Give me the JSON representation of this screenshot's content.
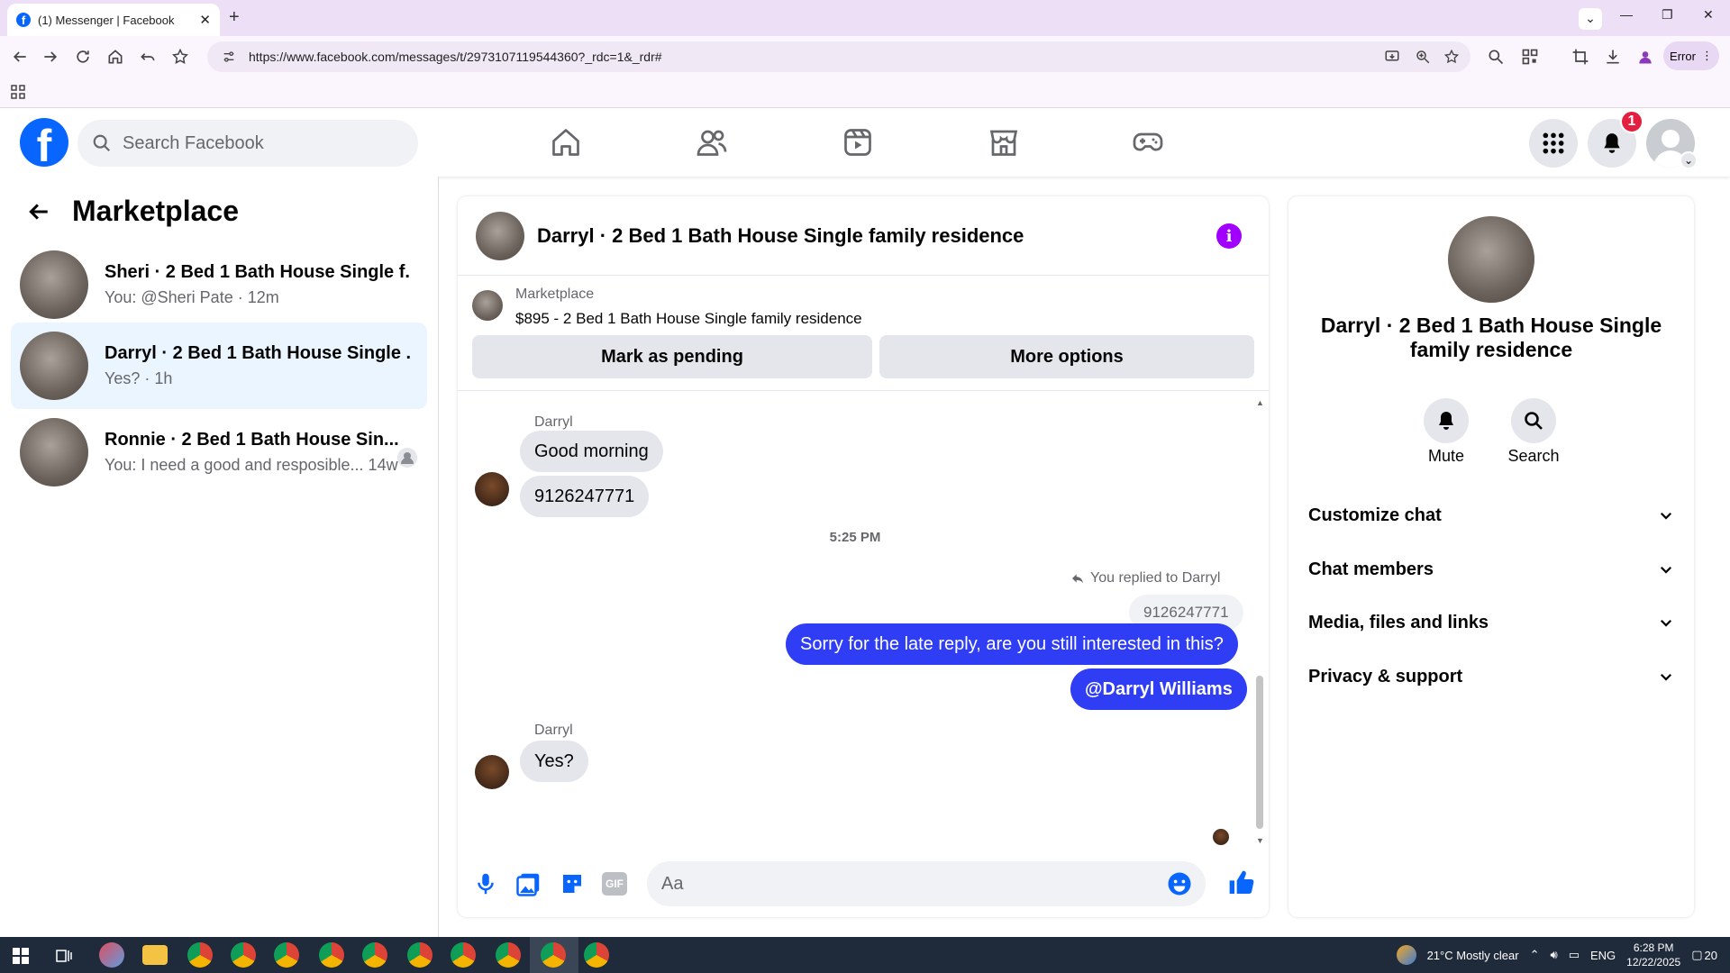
{
  "browser": {
    "tab_title": "(1) Messenger | Facebook",
    "url": "https://www.facebook.com/messages/t/2973107119544360?_rdc=1&_rdr#",
    "profile_button": "Error"
  },
  "fb": {
    "logo": "f",
    "search_placeholder": "Search Facebook",
    "notification_count": "1"
  },
  "left": {
    "title": "Marketplace",
    "conversations": [
      {
        "name": "Sheri · 2 Bed 1 Bath House Single f...",
        "preview": "You: @Sheri Pate · 12m"
      },
      {
        "name": "Darryl · 2 Bed 1 Bath House Single ...",
        "preview": "Yes? · 1h"
      },
      {
        "name": "Ronnie · 2 Bed 1 Bath House Sin...",
        "preview": "You: I need a good and resposible... 14w"
      }
    ]
  },
  "chat": {
    "title": "Darryl · 2 Bed 1 Bath House Single family residence",
    "marketplace_label": "Marketplace",
    "listing": "$895 - 2 Bed 1 Bath House Single family residence",
    "mark_pending": "Mark as pending",
    "more_options": "More options",
    "messages": {
      "sender1": "Darryl",
      "msg1": "Good morning",
      "msg2": "9126247771",
      "time": "5:25 PM",
      "reply_note": "You replied to Darryl",
      "quoted": "9126247771",
      "out1": "Sorry for the late reply, are you still interested in this?",
      "out2": "@Darryl Williams",
      "sender2": "Darryl",
      "msg3": "Yes?"
    },
    "composer_placeholder": "Aa"
  },
  "right": {
    "name": "Darryl · 2 Bed 1 Bath House Single family residence",
    "mute": "Mute",
    "search": "Search",
    "sections": [
      "Customize chat",
      "Chat members",
      "Media, files and links",
      "Privacy & support"
    ]
  },
  "taskbar": {
    "weather": "21°C  Mostly clear",
    "lang": "ENG",
    "time": "6:28 PM",
    "date": "12/22/2025",
    "notif": "20"
  },
  "colors": {
    "fb_blue": "#0866ff",
    "outgoing_bubble": "#2f3df5",
    "info_purple": "#a100ff",
    "badge_red": "#e41e3f"
  }
}
